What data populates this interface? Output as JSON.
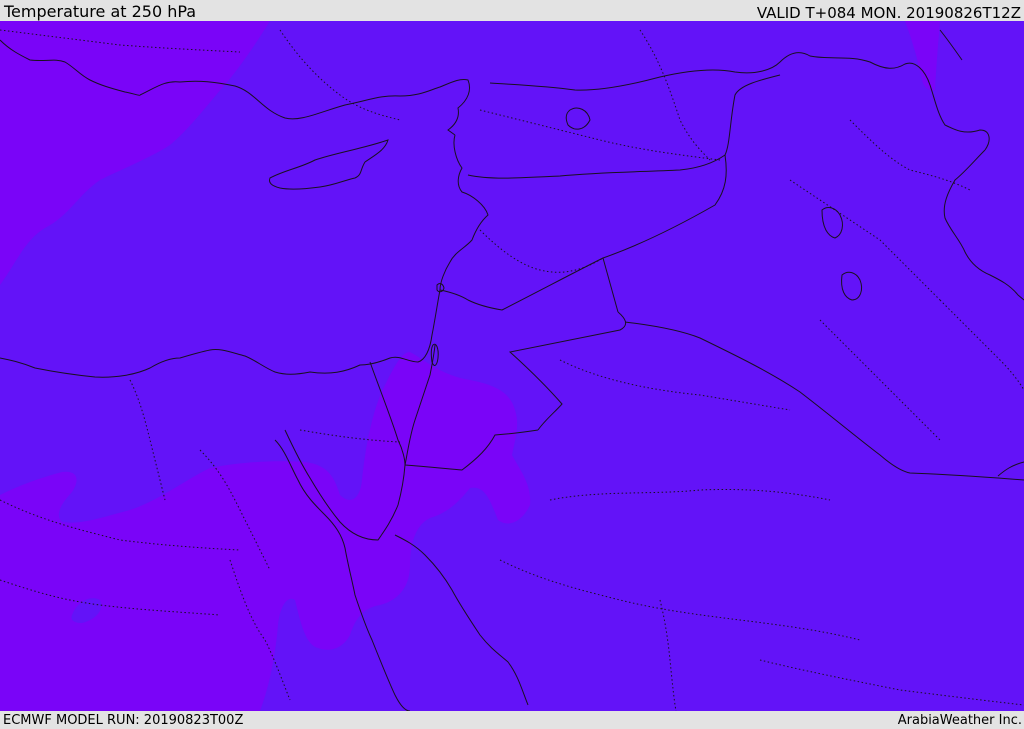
{
  "header": {
    "title": "Temperature at 250 hPa",
    "valid": "VALID T+084 MON. 20190826T12Z"
  },
  "footer": {
    "model_run": "ECMWF MODEL RUN: 20190823T00Z",
    "credit": "ArabiaWeather Inc."
  },
  "map": {
    "colors": {
      "background_field": "#6313f8",
      "warm_field": "#7a04f8",
      "coastline": "#1a1020",
      "borders": "#1a1020",
      "bars": "#e3e3e3"
    }
  }
}
